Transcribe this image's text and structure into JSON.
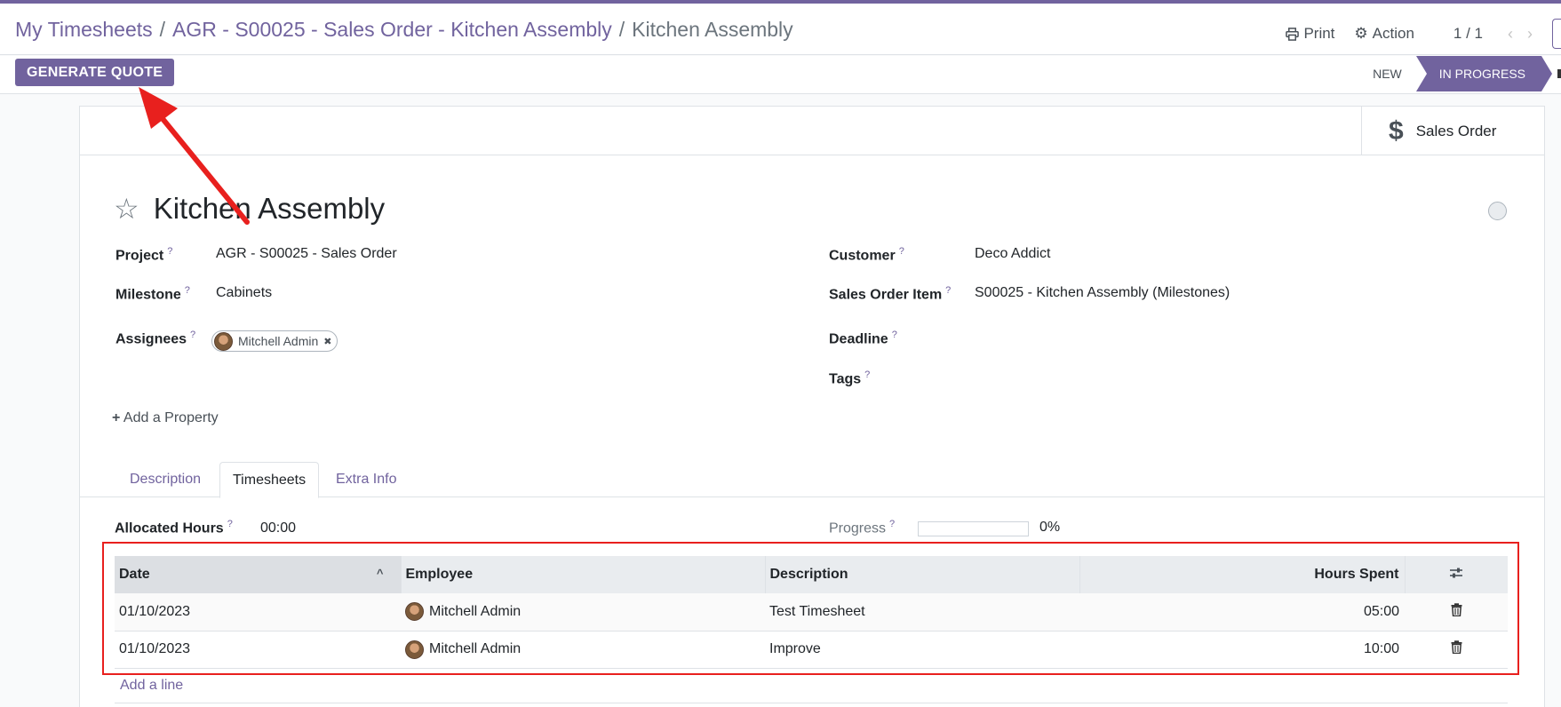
{
  "breadcrumb": {
    "items": [
      "My Timesheets",
      "AGR - S00025 - Sales Order - Kitchen Assembly"
    ],
    "separator": "/",
    "current": "Kitchen Assembly"
  },
  "header": {
    "print_label": "Print",
    "action_label": "Action",
    "pager": "1 / 1",
    "print_icon": "printer-icon",
    "action_icon": "gear-icon"
  },
  "controls": {
    "generate_quote_label": "GENERATE QUOTE",
    "stages": [
      "NEW",
      "IN PROGRESS"
    ],
    "active_stage": "IN PROGRESS"
  },
  "smart_button": {
    "icon": "dollar-icon",
    "label": "Sales Order"
  },
  "task": {
    "title": "Kitchen Assembly",
    "fields_left": {
      "project_label": "Project",
      "project_value": "AGR - S00025 - Sales Order",
      "milestone_label": "Milestone",
      "milestone_value": "Cabinets",
      "assignees_label": "Assignees",
      "assignee_name": "Mitchell Admin"
    },
    "fields_right": {
      "customer_label": "Customer",
      "customer_value": "Deco Addict",
      "sales_order_item_label": "Sales Order Item",
      "sales_order_item_value": "S00025 - Kitchen Assembly (Milestones)",
      "deadline_label": "Deadline",
      "tags_label": "Tags"
    },
    "help_marker": "?",
    "add_property": "Add a Property"
  },
  "tabs": [
    "Description",
    "Timesheets",
    "Extra Info"
  ],
  "active_tab": "Timesheets",
  "timesheets": {
    "allocated_hours_label": "Allocated Hours",
    "allocated_hours_value": "00:00",
    "progress_label": "Progress",
    "progress_value": "0%",
    "progress_fraction": 0,
    "columns": [
      "Date",
      "Employee",
      "Description",
      "Hours Spent"
    ],
    "rows": [
      {
        "date": "01/10/2023",
        "employee": "Mitchell Admin",
        "description": "Test Timesheet",
        "hours": "05:00"
      },
      {
        "date": "01/10/2023",
        "employee": "Mitchell Admin",
        "description": "Improve",
        "hours": "10:00"
      }
    ],
    "add_line": "Add a line"
  },
  "colors": {
    "brand": "#71639e",
    "annotation": "#e8201e"
  }
}
